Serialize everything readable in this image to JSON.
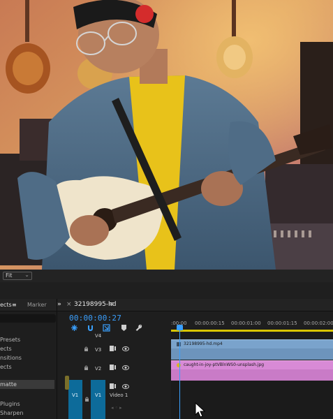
{
  "monitor": {
    "zoom_label": "Fit"
  },
  "effects_panel": {
    "tab_effects": "ects",
    "tab_effects_menu": "≡",
    "tab_markers": "Marker",
    "items": [
      {
        "label": "Presets"
      },
      {
        "label": "ects"
      },
      {
        "label": "nsitions"
      },
      {
        "label": "ects"
      },
      {
        "label": "matte"
      },
      {
        "label": "Plugins"
      },
      {
        "label": "Sharpen"
      }
    ]
  },
  "timeline": {
    "tab_more": "»",
    "tab_close": "×",
    "sequence_name": "32198995-hd",
    "sequence_menu": "≡",
    "timecode": "00:00:00:27",
    "ruler": [
      ":00:00",
      "00:00:00:15",
      "00:00:01:00",
      "00:00:01:15",
      "00:00:02:00"
    ],
    "tracks": [
      {
        "name": "V4"
      },
      {
        "name": "V3"
      },
      {
        "name": "V2"
      },
      {
        "name": "Video 1"
      }
    ],
    "source_patch": "V1",
    "target_patch": "V1",
    "clips": [
      {
        "name": "32198995-hd.mp4",
        "color": "#7aa3cc"
      },
      {
        "name": "caught-in-joy-ptVBlnWS0-unsplash.jpg",
        "color": "#d88ad6"
      }
    ],
    "accent_color": "#3aa0ff"
  }
}
